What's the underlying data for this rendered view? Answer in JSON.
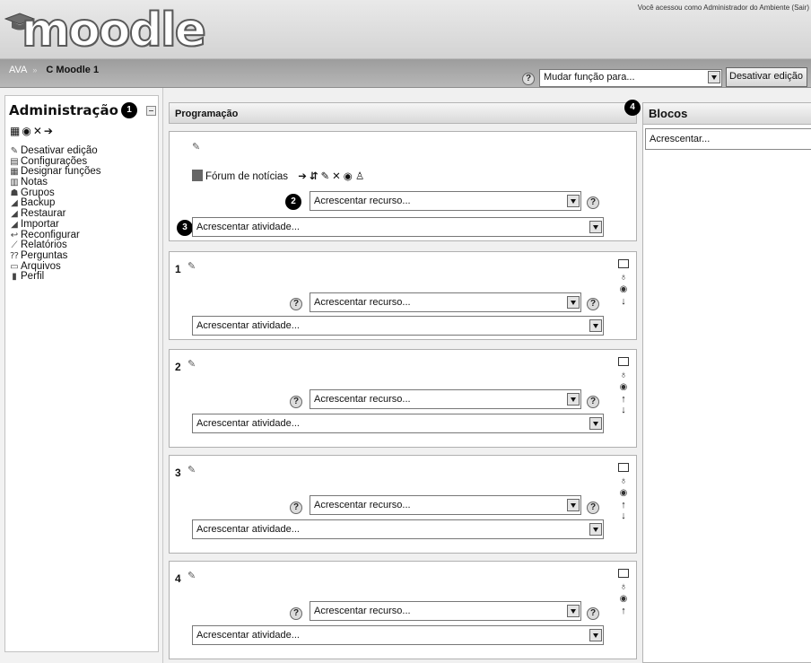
{
  "header": {
    "logo_text": "moodle",
    "login_info": "Você acessou como Administrador do Ambiente (Sair)"
  },
  "navbar": {
    "home": "AVA",
    "separator": "»",
    "course": "C Moodle 1",
    "role_select_value": "Mudar função para...",
    "edit_button": "Desativar edição"
  },
  "admin": {
    "title": "Administração",
    "badge": "1",
    "items": [
      {
        "label": "Desativar edição",
        "icon": "pencil-icon"
      },
      {
        "label": "Configurações",
        "icon": "settings-icon"
      },
      {
        "label": "Designar funções",
        "icon": "roles-icon"
      },
      {
        "label": "Notas",
        "icon": "grades-icon"
      },
      {
        "label": "Grupos",
        "icon": "groups-icon"
      },
      {
        "label": "Backup",
        "icon": "backup-icon"
      },
      {
        "label": "Restaurar",
        "icon": "restore-icon"
      },
      {
        "label": "Importar",
        "icon": "import-icon"
      },
      {
        "label": "Reconfigurar",
        "icon": "reset-icon"
      },
      {
        "label": "Relatórios",
        "icon": "reports-icon"
      },
      {
        "label": "Perguntas",
        "icon": "questions-icon"
      },
      {
        "label": "Arquivos",
        "icon": "folder-icon"
      },
      {
        "label": "Perfil",
        "icon": "profile-icon"
      }
    ]
  },
  "main": {
    "title": "Programação",
    "forum_label": "Fórum de notícias",
    "add_resource": "Acrescentar recurso...",
    "add_activity": "Acrescentar atividade...",
    "badge_resource": "2",
    "badge_activity": "3",
    "sections": [
      {
        "num": "1"
      },
      {
        "num": "2"
      },
      {
        "num": "3"
      },
      {
        "num": "4"
      }
    ]
  },
  "blocks": {
    "title": "Blocos",
    "badge": "4",
    "add_value": "Acrescentar..."
  }
}
